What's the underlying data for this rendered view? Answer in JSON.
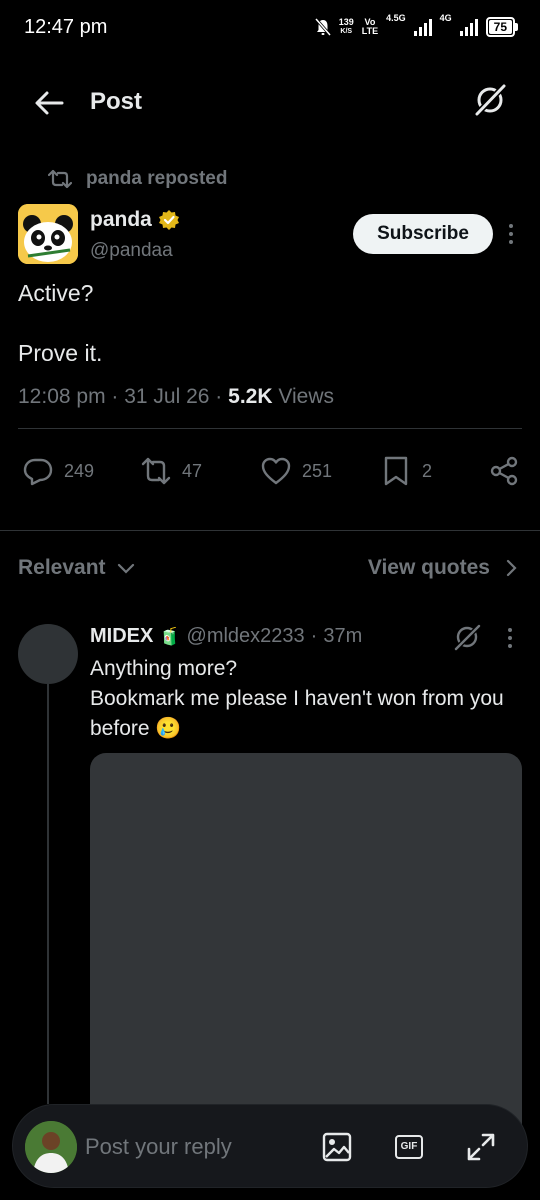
{
  "status_bar": {
    "time": "12:47 pm",
    "speed_value": "139",
    "speed_unit": "K/S",
    "volte_top": "Vo",
    "volte_bottom": "LTE",
    "net1": "4.5G",
    "net2": "4G",
    "battery": "75"
  },
  "header": {
    "title": "Post"
  },
  "post": {
    "repost_label": "panda reposted",
    "author_name": "panda",
    "author_handle": "@pandaa",
    "subscribe_label": "Subscribe",
    "text_line1": "Active?",
    "text_line2": "Prove it.",
    "time": "12:08 pm",
    "date": "31 Jul 26",
    "views_count": "5.2K",
    "views_label": "Views",
    "replies": "249",
    "reposts": "47",
    "likes": "251",
    "bookmarks": "2"
  },
  "sort": {
    "relevant_label": "Relevant",
    "view_quotes_label": "View quotes"
  },
  "reply": {
    "name": "MIDEX",
    "badge_emoji": "🧃",
    "handle": "@mldex2233",
    "time": "37m",
    "text_line1": "Anything more?",
    "text_line2": "Bookmark me please I haven't won from you before 🥲"
  },
  "composer": {
    "placeholder": "Post your reply",
    "gif_label": "GIF"
  },
  "colors": {
    "background": "#000000",
    "secondary_text": "#71767b",
    "primary_text": "#e7e9ea",
    "verified_gold": "#e2b719",
    "divider": "#2f3336"
  }
}
